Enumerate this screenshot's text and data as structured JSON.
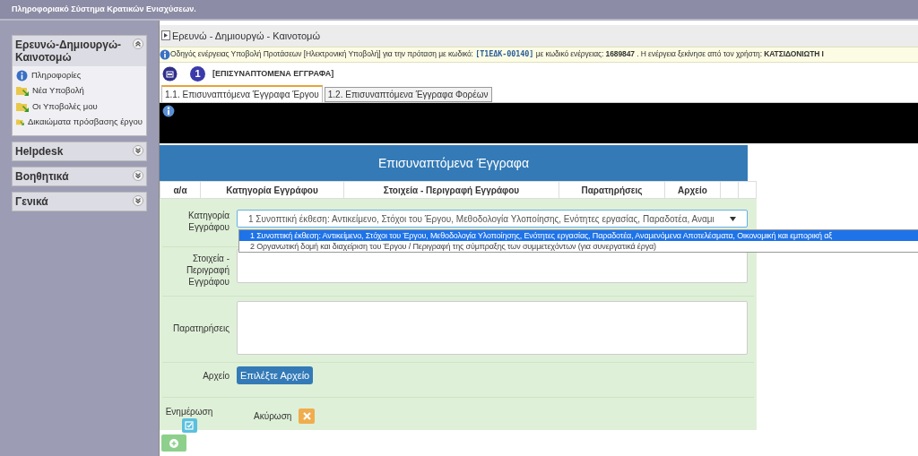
{
  "app_title": "Πληροφοριακό Σύστημα Κρατικών Ενισχύσεων.",
  "sidebar": [
    {
      "title": "Ερευνώ-Δημιουργώ-Καινοτομώ",
      "expanded": true,
      "items": [
        {
          "label": "Πληροφορίες",
          "kind": "info"
        },
        {
          "label": "Νέα Υποβολή",
          "kind": "folder"
        },
        {
          "label": "Οι Υποβολές μου",
          "kind": "folder"
        },
        {
          "label": "Δικαιώματα πρόσβασης έργου",
          "kind": "folder"
        }
      ]
    },
    {
      "title": "Helpdesk",
      "expanded": false
    },
    {
      "title": "Βοηθητικά",
      "expanded": false
    },
    {
      "title": "Γενικά",
      "expanded": false
    }
  ],
  "breadcrumb": "Ερευνώ - Δημιουργώ - Καινοτομώ",
  "info_bar": {
    "parts": [
      {
        "text": "Οδηγός ενέργειας Υποβολή Προτάσεων [Ηλεκτρονική Υποβολή] για την πρόταση με κωδικό: ",
        "kind": "plain"
      },
      {
        "text": "[Τ1ΕΔΚ-00140]",
        "kind": "code"
      },
      {
        "text": " με κωδικό ενέργειας: ",
        "kind": "plain"
      },
      {
        "text": "1689847",
        "kind": "bold"
      },
      {
        "text": " . Η ενέργεια ξεκίνησε από τον χρήστη: ",
        "kind": "plain"
      },
      {
        "text": "ΚΑΤΣΙΔΟΝΙΩΤΗ Ι",
        "kind": "bold"
      }
    ]
  },
  "step": {
    "number": "1",
    "label": "[ΕΠΙΣΥΝΑΠΤΟΜΕΝΑ ΕΓΓΡΑΦΑ]"
  },
  "tabs": [
    {
      "label": "1.1. Επισυναπτόμενα Έγγραφα Έργου",
      "selected": true
    },
    {
      "label": "1.2. Επισυναπτόμενα Έγγραφα Φορέων",
      "selected": false
    }
  ],
  "panel_title": "Επισυναπτόμενα Έγγραφα",
  "table": {
    "columns": [
      "α/α",
      "Κατηγορία Εγγράφου",
      "Στοιχεία - Περιγραφή Εγγράφου",
      "Παρατηρήσεις",
      "Αρχείο"
    ]
  },
  "form": {
    "category_label": "Κατηγορία Εγγράφου",
    "category_value": "1 Συνοπτική έκθεση: Αντικείμενο, Στόχοι του Έργου, Μεθοδολογία Υλοποίησης, Ενότητες εργασίας, Παραδοτέα, Αναμι",
    "options": [
      {
        "label": "1 Συνοπτική έκθεση: Αντικείμενο, Στόχοι του Έργου, Μεθοδολογία Υλοποίησης, Ενότητες εργασίας, Παραδοτέα, Αναμενόμενα Αποτελέσματα, Οικονομική και εμπορική αξ",
        "selected": true
      },
      {
        "label": "2 Οργανωτική δομή και διαχείριση του Έργου / Περιγραφή της σύμπραξης των συμμετεχόντων (για συνεργατικά έργα)",
        "selected": false
      }
    ],
    "description_label": "Στοιχεία - Περιγραφή Εγγράφου",
    "remarks_label": "Παρατηρήσεις",
    "file_label": "Αρχείο",
    "file_button": "Επιλέξτε Αρχείο",
    "update_label": "Ενημέρωση",
    "cancel_label": "Ακύρωση"
  }
}
